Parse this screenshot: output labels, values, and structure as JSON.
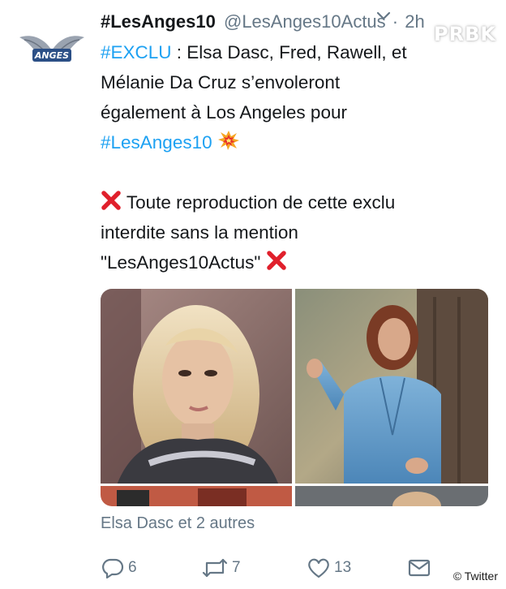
{
  "tweet": {
    "display_name": "#LesAnges10",
    "handle": "@LesAnges10Actus",
    "separator": "·",
    "time": "2h",
    "avatar_text": "ANGES",
    "body": {
      "hashtag_exclu": "#EXCLU",
      "line1_rest": " : Elsa Dasc, Fred, Rawell, et",
      "line2": "Mélanie Da Cruz s’envoleront",
      "line3": "également à Los Angeles pour",
      "hashtag_anges": "#LesAnges10",
      "line5": " Toute reproduction de cette exclu",
      "line6": "interdite sans la mention",
      "line7": "\"LesAnges10Actus\" "
    },
    "media_caption": "Elsa Dasc et 2 autres",
    "actions": {
      "replies": "6",
      "retweets": "7",
      "likes": "13"
    }
  },
  "watermark": "PRBK",
  "credit": "© Twitter",
  "colors": {
    "link": "#1da1f2",
    "text": "#14171a",
    "muted": "#657786",
    "cross": "#e0202c"
  }
}
